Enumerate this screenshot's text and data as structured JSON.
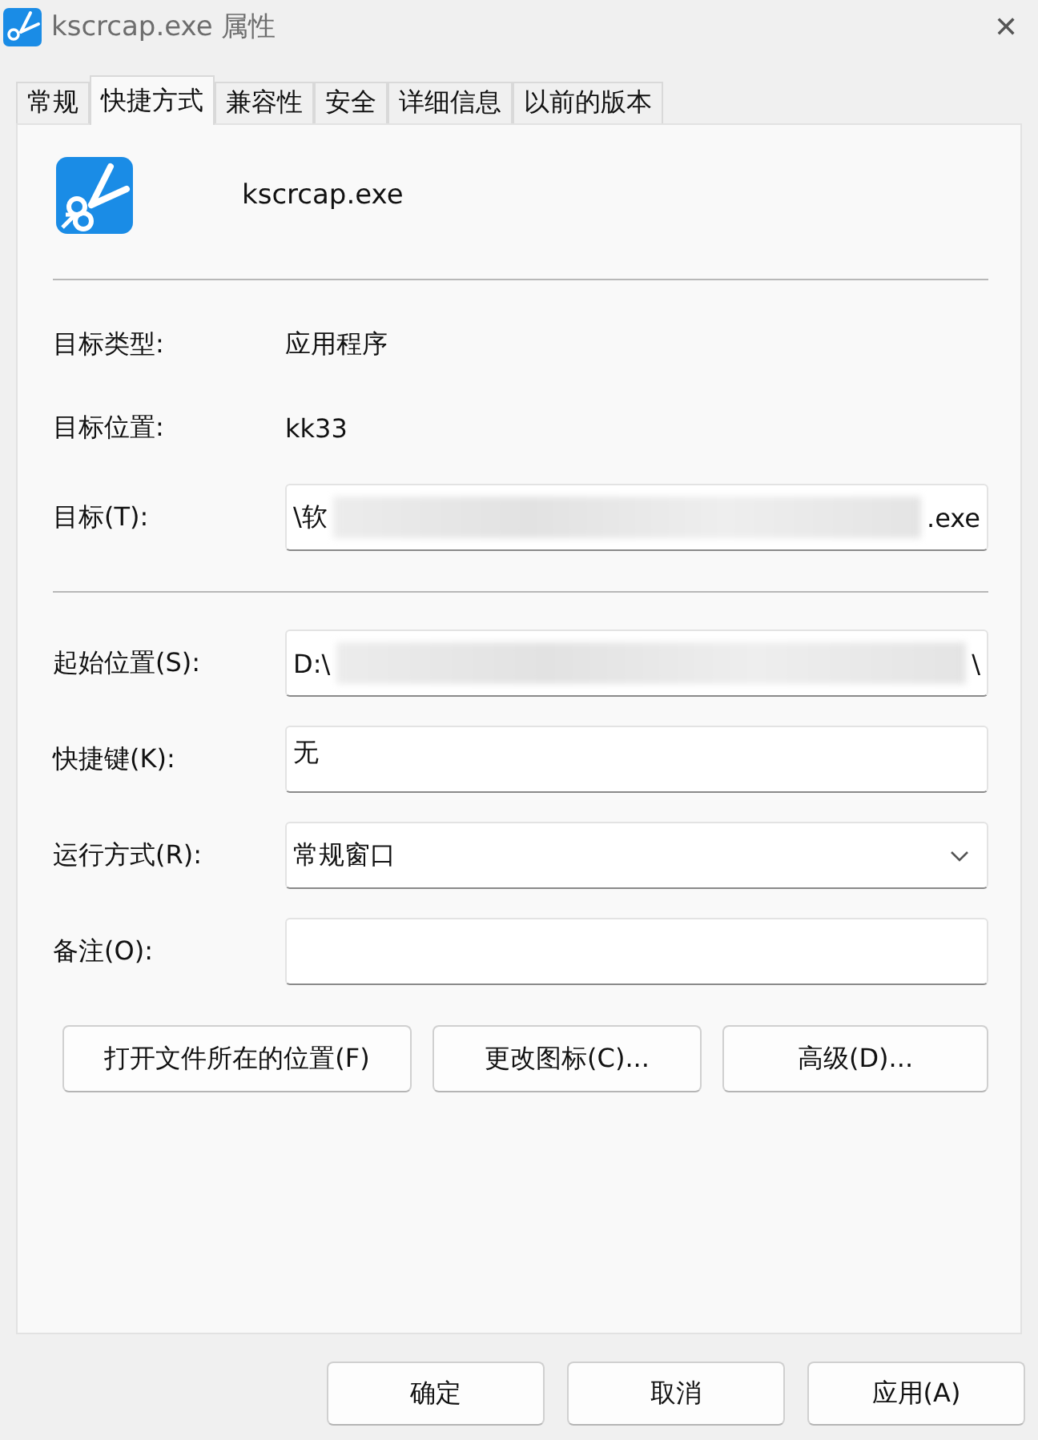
{
  "window": {
    "title": "kscrcap.exe 属性",
    "close": "✕"
  },
  "tabs": [
    {
      "label": "常规",
      "selected": false
    },
    {
      "label": "快捷方式",
      "selected": true
    },
    {
      "label": "兼容性",
      "selected": false
    },
    {
      "label": "安全",
      "selected": false
    },
    {
      "label": "详细信息",
      "selected": false
    },
    {
      "label": "以前的版本",
      "selected": false
    }
  ],
  "file_name": "kscrcap.exe",
  "info": [
    {
      "label": "目标类型:",
      "value": "应用程序"
    },
    {
      "label": "目标位置:",
      "value": "kk33"
    }
  ],
  "target": {
    "label": "目标(T):",
    "prefix": "\\软",
    "suffix": ".exe"
  },
  "fields": [
    {
      "kind": "redacted",
      "label": "起始位置(S):",
      "prefix": "D:\\",
      "suffix": "\\"
    },
    {
      "kind": "text",
      "label": "快捷键(K):",
      "value": "无"
    },
    {
      "kind": "select",
      "label": "运行方式(R):",
      "value": "常规窗口"
    },
    {
      "kind": "text",
      "label": "备注(O):"
    }
  ],
  "actions": [
    "打开文件所在的位置(F)",
    "更改图标(C)...",
    "高级(D)..."
  ],
  "buttons": [
    {
      "label": "确定",
      "disabled": false
    },
    {
      "label": "取消",
      "disabled": false
    },
    {
      "label": "应用(A)",
      "disabled": false
    }
  ]
}
